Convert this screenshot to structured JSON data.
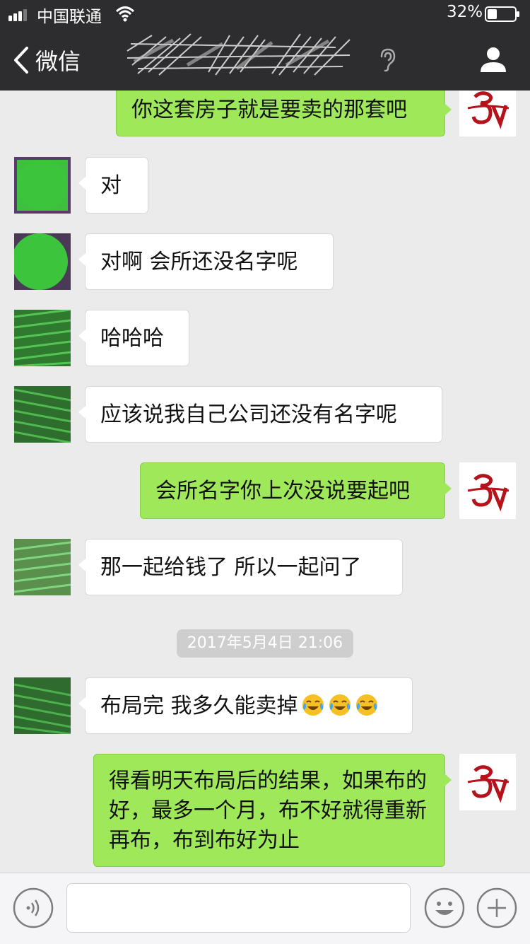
{
  "status_bar": {
    "carrier": "中国联通",
    "battery_percent": "32%"
  },
  "nav": {
    "back_label": "微信",
    "chat_title": "",
    "icons": [
      "chevron-left-icon",
      "ear-icon",
      "profile-icon"
    ]
  },
  "messages": [
    {
      "dir": "out",
      "text": "你这套房子就是要卖的那套吧"
    },
    {
      "dir": "in",
      "text": "对"
    },
    {
      "dir": "in",
      "text": "对啊 会所还没名字呢"
    },
    {
      "dir": "in",
      "text": "哈哈哈"
    },
    {
      "dir": "in",
      "text": "应该说我自己公司还没有名字呢"
    },
    {
      "dir": "out",
      "text": "会所名字你上次没说要起吧"
    },
    {
      "dir": "in",
      "text": "那一起给钱了 所以一起问了"
    },
    {
      "dir": "in",
      "text": "布局完 我多久能卖掉",
      "emoji_count": 3,
      "emoji": "crying-laughing-emoji"
    },
    {
      "dir": "out",
      "text": "得看明天布局后的结果，如果布的好，最多一个月，布不好就得重新再布，布到布好为止"
    }
  ],
  "timestamp": "2017年5月4日 21:06",
  "input_bar": {
    "placeholder": "",
    "icons": [
      "voice-icon",
      "emoji-face-icon",
      "plus-icon"
    ]
  },
  "colors": {
    "header_bg": "#2d2d2f",
    "chat_bg": "#ebebeb",
    "outgoing_bubble": "#9fe85a",
    "incoming_bubble": "#ffffff",
    "avatar_logo": "#b5121b"
  }
}
